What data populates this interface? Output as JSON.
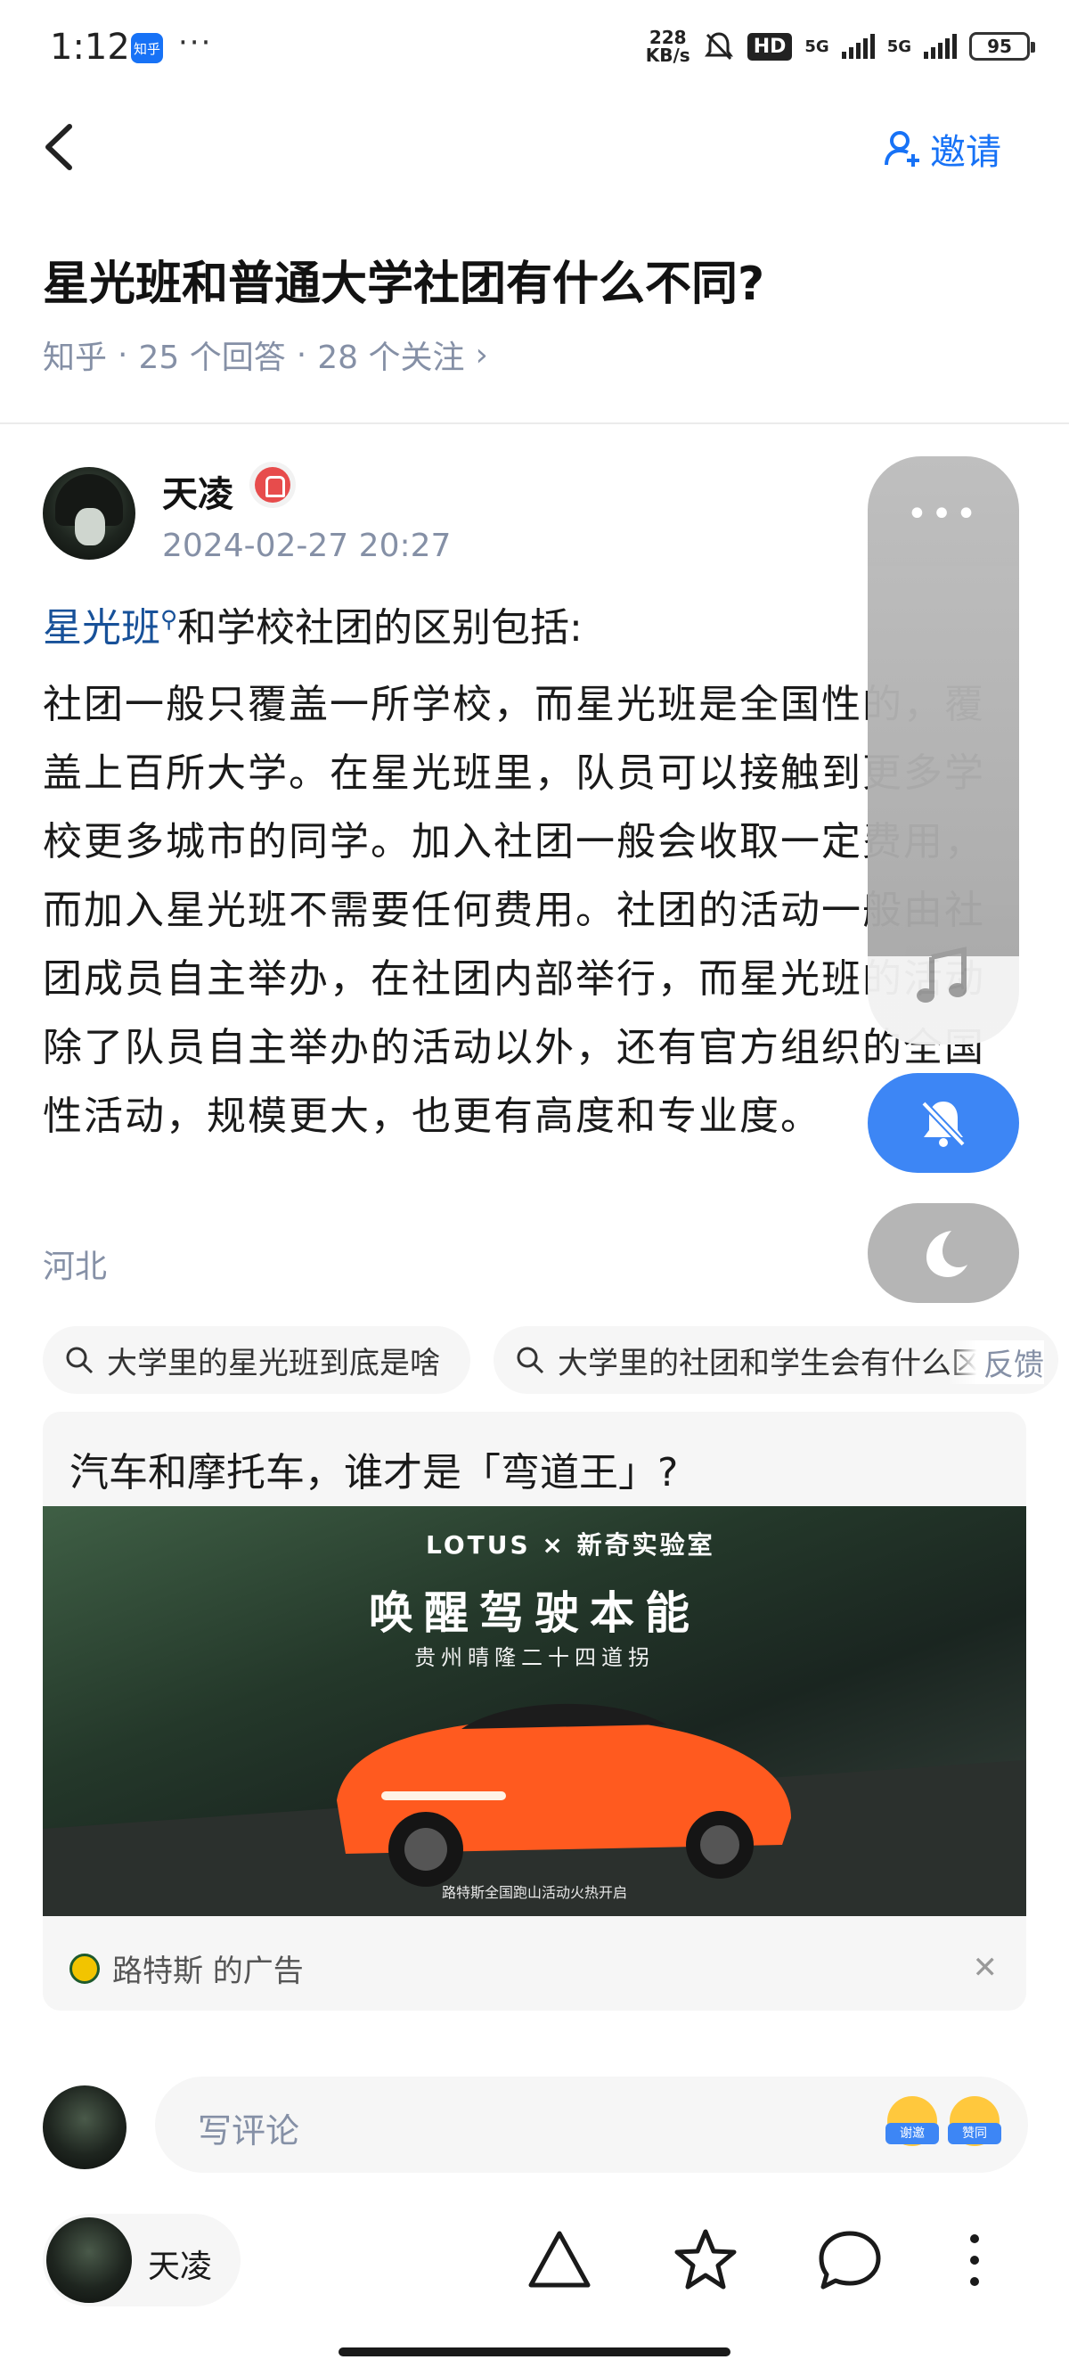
{
  "status_bar": {
    "time": "1:12",
    "app_badge": "知乎",
    "more": "···",
    "net_speed_value": "228",
    "net_speed_unit": "KB/s",
    "hd": "HD",
    "sim1": "5G",
    "sim2": "5G",
    "battery": "95"
  },
  "nav": {
    "invite_label": "邀请"
  },
  "question": {
    "title": "星光班和普通大学社团有什么不同?",
    "source": "知乎",
    "answers": "25 个回答",
    "followers": "28 个关注",
    "sep": "·",
    "chevron": "›"
  },
  "answer": {
    "author": "天凌",
    "date": "2024-02-27 20:27",
    "lead_link": "星光班",
    "lead_rest": "和学校社团的区别包括:",
    "body": "社团一般只覆盖一所学校，而星光班是全国性的，覆盖上百所大学。在星光班里，队员可以接触到更多学校更多城市的同学。加入社团一般会收取一定费用，而加入星光班不需要任何费用。社团的活动一般由社团成员自主举办，在社团内部举行，而星光班的活动除了队员自主举办的活动以外，还有官方组织的全国性活动，规模更大，也更有高度和专业度。",
    "location": "河北"
  },
  "related": {
    "chips": [
      "大学里的星光班到底是啥",
      "大学里的社团和学生会有什么区别"
    ],
    "feedback": "反馈"
  },
  "ad": {
    "title": "汽车和摩托车，谁才是「弯道王」?",
    "brand": "LOTUS × 新奇实验室",
    "headline": "唤醒驾驶本能",
    "subline": "贵州晴隆二十四道拐",
    "caption": "路特斯全国跑山活动火热开启",
    "advertiser": "路特斯 的广告",
    "close": "✕"
  },
  "comment": {
    "placeholder": "写评论",
    "emoji_thanks": "谢邀",
    "emoji_agree": "赞同"
  },
  "bottom": {
    "author": "天凌"
  },
  "icons": {
    "back": "chevron-left-icon",
    "invite": "add-user-icon",
    "search": "search-icon",
    "vote": "triangle-up-icon",
    "favorite": "star-icon",
    "comment": "comment-bubble-icon",
    "more": "vertical-dots-icon",
    "music": "music-note-icon",
    "mute": "bell-off-icon",
    "dark_mode": "moon-icon"
  },
  "colors": {
    "accent": "#1772f6",
    "link": "#175199",
    "meta": "#8590a6"
  }
}
